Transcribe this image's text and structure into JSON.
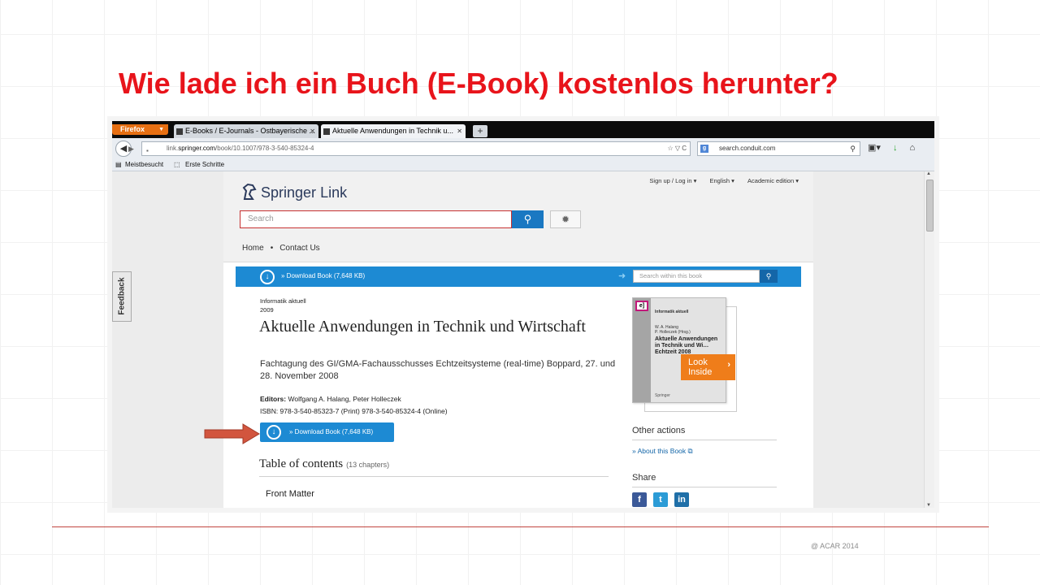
{
  "slide": {
    "title": "Wie lade ich ein Buch (E-Book) kostenlos herunter?",
    "footer": "@ ACAR 2014"
  },
  "browser": {
    "firefox_button": "Firefox",
    "tabs": [
      {
        "label": "E-Books / E-Journals - Ostbayerische ..."
      },
      {
        "label": "Aktuelle Anwendungen in Technik u..."
      }
    ],
    "new_tab": "+",
    "url_prefix": "link.",
    "url_domain": "springer.com",
    "url_path": "/book/10.1007/978-3-540-85324-4",
    "url_tools": "☆ ▽ C",
    "search_engine_query": "search.conduit.com",
    "bookmarks": [
      "Meistbesucht",
      "Erste Schritte"
    ]
  },
  "springer": {
    "logo_springer": "Springer",
    "logo_link": "Link",
    "header_links": [
      "Sign up / Log in ▾",
      "English ▾",
      "Academic edition ▾"
    ],
    "search_placeholder": "Search",
    "breadcrumb": [
      "Home",
      "Contact Us"
    ],
    "download_bar_label": "» Download Book (7,648 KB)",
    "search_within_placeholder": "Search within this book",
    "series": "Informatik aktuell",
    "year": "2009",
    "book_title": "Aktuelle Anwendungen in Technik und Wirtschaft",
    "subtitle": "Fachtagung des GI/GMA-Fachausschusses Echtzeitsysteme (real-time) Boppard, 27. und 28. November 2008",
    "editors_label": "Editors:",
    "editors": "Wolfgang A. Halang, Peter Holleczek",
    "isbn": "ISBN: 978-3-540-85323-7 (Print) 978-3-540-85324-4 (Online)",
    "download_button_label": "» Download Book (7,648 KB)",
    "toc_title": "Table of contents",
    "toc_count": "(13 chapters)",
    "toc_first": "Front Matter",
    "cover": {
      "badge": "e]",
      "series": "Informatik aktuell",
      "authors": "W. A. Halang\nP. Holleczek (Hrsg.)",
      "title": "Aktuelle Anwendungen in Technik und Wi… Echtzeit 2008",
      "publisher": "Springer"
    },
    "look_inside": "Look Inside",
    "other_actions_title": "Other actions",
    "about_link": "» About this Book",
    "share_title": "Share",
    "feedback": "Feedback"
  }
}
